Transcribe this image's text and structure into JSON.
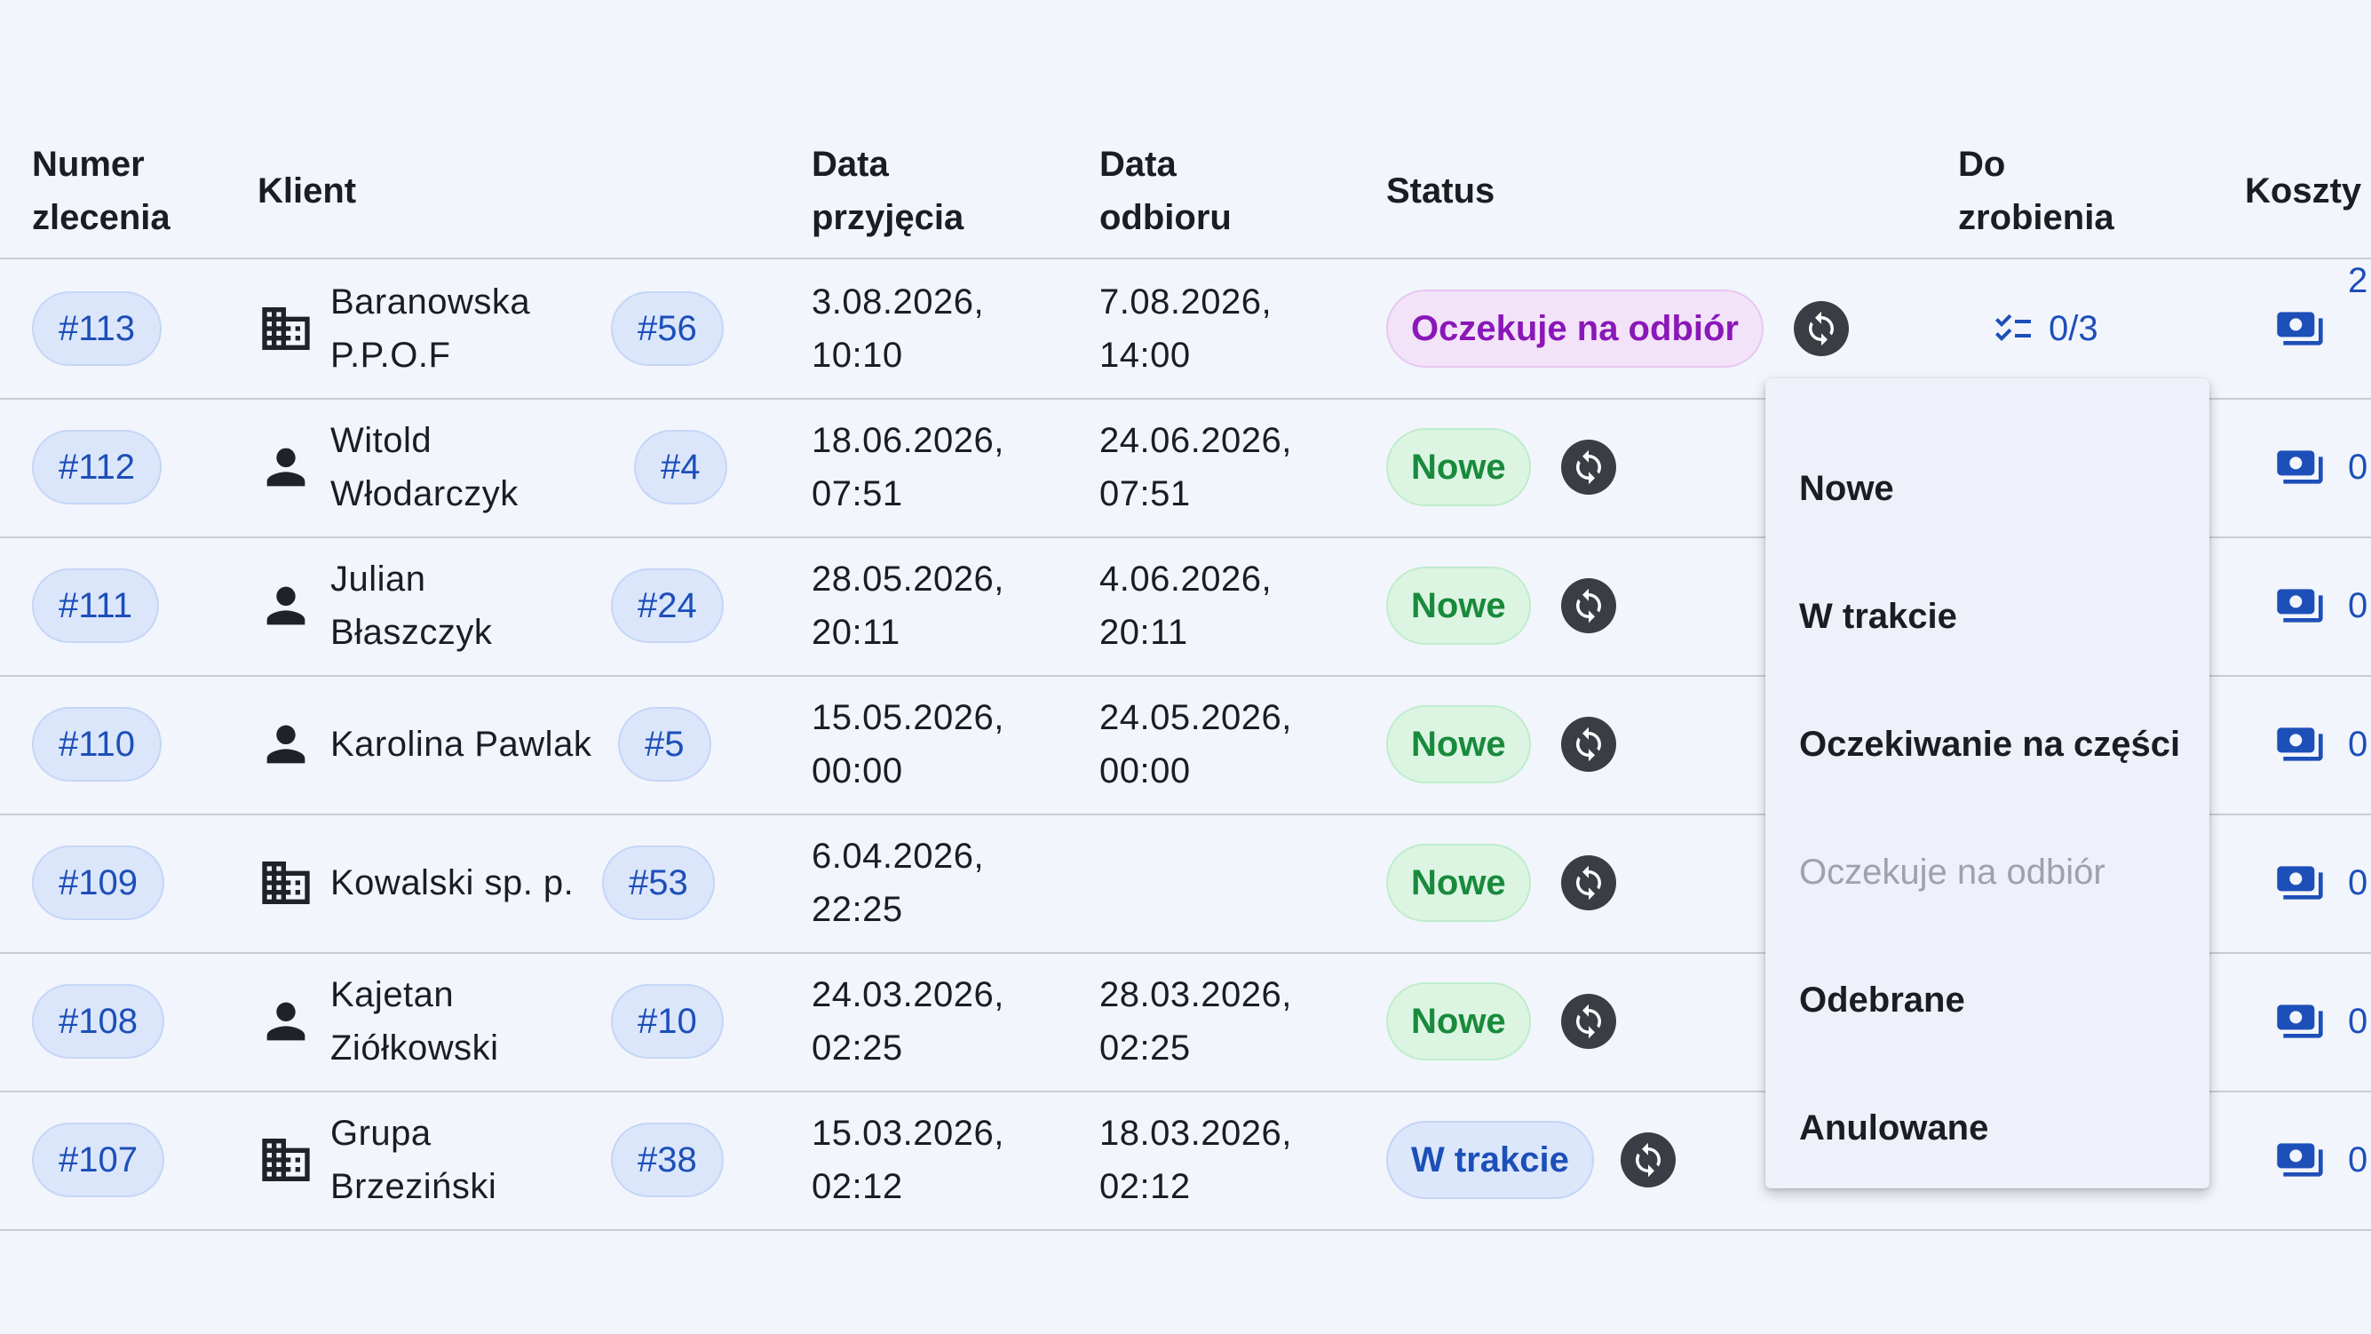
{
  "table": {
    "headers": {
      "order_number": [
        "Numer",
        "zlecenia"
      ],
      "client": "Klient",
      "received_date": [
        "Data",
        "przyjęcia"
      ],
      "pickup_date": [
        "Data",
        "odbioru"
      ],
      "status": "Status",
      "todo": [
        "Do",
        "zrobienia"
      ],
      "costs": "Koszty"
    },
    "rows": [
      {
        "id": "#113",
        "client_type": "company",
        "client": [
          "Baranowska",
          "P.P.O.F"
        ],
        "client_id": "#56",
        "received": [
          "3.08.2026,",
          "10:10"
        ],
        "pickup": [
          "7.08.2026,",
          "14:00"
        ],
        "status": "Oczekuje na odbiór",
        "status_color": "purple",
        "todo": "0/3",
        "cost": "2"
      },
      {
        "id": "#112",
        "client_type": "person",
        "client": [
          "Witold",
          "Włodarczyk"
        ],
        "client_id": "#4",
        "received": [
          "18.06.2026,",
          "07:51"
        ],
        "pickup": [
          "24.06.2026,",
          "07:51"
        ],
        "status": "Nowe",
        "status_color": "green",
        "todo": "",
        "cost": "0,"
      },
      {
        "id": "#111",
        "client_type": "person",
        "client": [
          "Julian",
          "Błaszczyk"
        ],
        "client_id": "#24",
        "received": [
          "28.05.2026,",
          "20:11"
        ],
        "pickup": [
          "4.06.2026,",
          "20:11"
        ],
        "status": "Nowe",
        "status_color": "green",
        "todo": "",
        "cost": "0,"
      },
      {
        "id": "#110",
        "client_type": "person",
        "client": [
          "Karolina Pawlak",
          ""
        ],
        "client_id": "#5",
        "received": [
          "15.05.2026,",
          "00:00"
        ],
        "pickup": [
          "24.05.2026,",
          "00:00"
        ],
        "status": "Nowe",
        "status_color": "green",
        "todo": "",
        "cost": "0,"
      },
      {
        "id": "#109",
        "client_type": "company",
        "client": [
          "Kowalski sp. p.",
          ""
        ],
        "client_id": "#53",
        "received": [
          "6.04.2026,",
          "22:25"
        ],
        "pickup": [
          "",
          ""
        ],
        "status": "Nowe",
        "status_color": "green",
        "todo": "",
        "cost": "0,"
      },
      {
        "id": "#108",
        "client_type": "person",
        "client": [
          "Kajetan",
          "Ziółkowski"
        ],
        "client_id": "#10",
        "received": [
          "24.03.2026,",
          "02:25"
        ],
        "pickup": [
          "28.03.2026,",
          "02:25"
        ],
        "status": "Nowe",
        "status_color": "green",
        "todo": "",
        "cost": "0,"
      },
      {
        "id": "#107",
        "client_type": "company",
        "client": [
          "Grupa",
          "Brzeziński"
        ],
        "client_id": "#38",
        "received": [
          "15.03.2026,",
          "02:12"
        ],
        "pickup": [
          "18.03.2026,",
          "02:12"
        ],
        "status": "W trakcie",
        "status_color": "blue",
        "todo": "",
        "cost": "0,"
      }
    ]
  },
  "status_menu": {
    "items": [
      {
        "label": "Nowe",
        "disabled": false
      },
      {
        "label": "W trakcie",
        "disabled": false
      },
      {
        "label": "Oczekiwanie na części",
        "disabled": false
      },
      {
        "label": "Oczekuje na odbiór",
        "disabled": true
      },
      {
        "label": "Odebrane",
        "disabled": false
      },
      {
        "label": "Anulowane",
        "disabled": false
      }
    ]
  },
  "colors": {
    "accent": "#1d4fb8",
    "status_green": "#198a3c",
    "status_purple": "#8a17b8",
    "status_blue": "#1d4fb8",
    "background": "#f2f5fc"
  },
  "icons": {
    "company": "building-icon",
    "person": "person-icon",
    "status_change": "sync-icon",
    "todo": "checklist-icon",
    "costs": "money-icon"
  }
}
